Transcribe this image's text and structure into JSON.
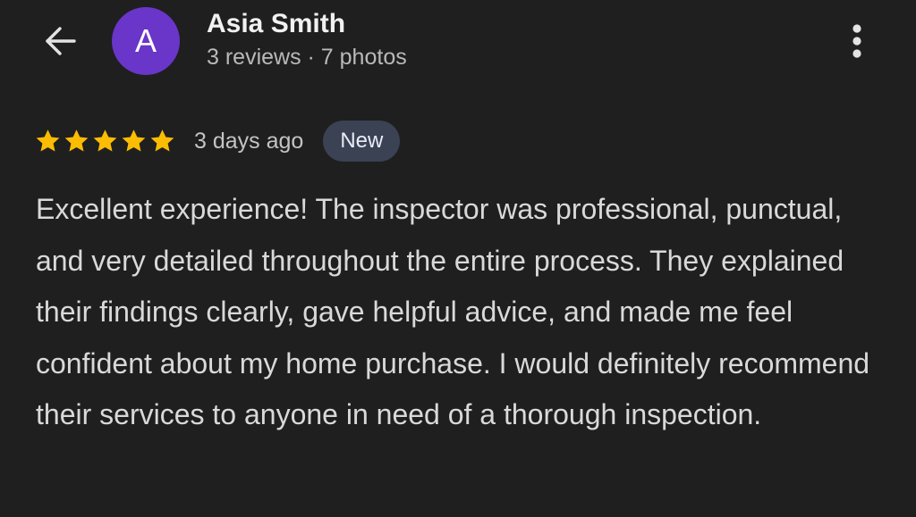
{
  "header": {
    "back_icon": "arrow-left-icon",
    "more_icon": "more-vert-icon",
    "avatar_initial": "A",
    "avatar_color": "#6a35c9",
    "user_name": "Asia Smith",
    "user_meta": "3 reviews · 7 photos"
  },
  "review": {
    "rating": 5,
    "rating_max": 5,
    "star_color": "#fbbc04",
    "date": "3 days ago",
    "badge": "New",
    "text": "Excellent experience! The inspector was professional, punctual, and very detailed throughout the entire process. They explained their findings clearly, gave helpful advice, and made me feel confident about my home purchase. I would definitely recommend their services to anyone in need of a thorough inspection."
  }
}
